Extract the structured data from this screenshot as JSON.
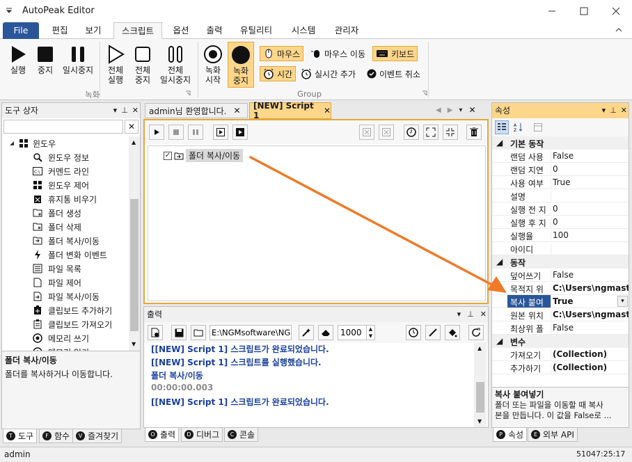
{
  "app": {
    "title": "AutoPeak Editor"
  },
  "ribbon": {
    "tabs": [
      "File",
      "편집",
      "보기",
      "스크립트",
      "옵션",
      "출력",
      "유틸리티",
      "시스템",
      "관리자"
    ],
    "active_tab": "스크립트",
    "group_record_label": "녹화",
    "group_group_label": "Group",
    "buttons": {
      "run": "실행",
      "stop": "중지",
      "pause": "일시중지",
      "run_all_1": "전체",
      "run_all_2": "실행",
      "stop_all_1": "전체",
      "stop_all_2": "중지",
      "pause_all_1": "전체",
      "pause_all_2": "일시중지",
      "rec_start_1": "녹화",
      "rec_start_2": "시작",
      "rec_stop_1": "녹화",
      "rec_stop_2": "중지",
      "mouse": "마우스",
      "mouse_move": "마우스 이동",
      "keyboard": "키보드",
      "time": "시간",
      "realtime_add": "실시간 추가",
      "event_cancel": "이벤트 취소"
    },
    "accent": "#2b579a",
    "highlight": "#fcd68a"
  },
  "toolbox": {
    "title": "도구 상자",
    "search_value": "",
    "root": "윈도우",
    "items": [
      "윈도우 정보",
      "커멘드 라인",
      "윈도우 제어",
      "휴지통 비우기",
      "폴더 생성",
      "폴더 삭제",
      "폴더 복사/이동",
      "폴더 변화 이벤트",
      "파일 목록",
      "파일 제어",
      "파일 복사/이동",
      "클립보드 추가하기",
      "클립보드 가져오기",
      "메모리 쓰기",
      "메모리 읽기"
    ],
    "desc_title": "폴더 복사/이동",
    "desc_text": "폴더를 복사하거나 이동합니다.",
    "bottom_tabs": [
      "도구",
      "함수",
      "즐겨찾기"
    ],
    "bottom_tab_keys": [
      "T",
      "F",
      "V"
    ]
  },
  "editor": {
    "tabs": [
      "admin님 환영합니다.",
      "[NEW] Script 1"
    ],
    "active_tab": "[NEW] Script 1",
    "script_node": "폴더 복사/이동",
    "node_checked": true
  },
  "output": {
    "title": "출력",
    "path_value": "E:\\NGMsoftware\\NG",
    "count_value": "1000",
    "lines": [
      {
        "text": "[[NEW] Script 1] 스크립트가 완료되었습니다.",
        "color": "#1a3fa0"
      },
      {
        "text": "[[NEW] Script 1] 스크립트를 실행했습니다.",
        "color": "#1a3fa0"
      },
      {
        "text": "폴더 복사/이동",
        "color": "#1a3fa0"
      },
      {
        "text": "00:00:00.003",
        "color": "#8c8c8c"
      },
      {
        "text": "[[NEW] Script 1] 스크립트가 완료되었습니다.",
        "color": "#1a3fa0"
      }
    ],
    "bottom_tabs": [
      "출력",
      "디버그",
      "콘솔"
    ],
    "bottom_tab_keys": [
      "O",
      "D",
      "C"
    ]
  },
  "properties": {
    "title": "속성",
    "categories": [
      {
        "name": "기본 동작",
        "rows": [
          {
            "name": "랜덤 사용",
            "value": "False"
          },
          {
            "name": "랜덤 지연",
            "value": "0"
          },
          {
            "name": "사용 여부",
            "value": "True"
          },
          {
            "name": "설명",
            "value": ""
          },
          {
            "name": "실행 전 지",
            "value": "0"
          },
          {
            "name": "실행 후 지",
            "value": "0"
          },
          {
            "name": "실행율",
            "value": "100"
          },
          {
            "name": "아이디",
            "value": ""
          }
        ]
      },
      {
        "name": "동작",
        "rows": [
          {
            "name": "덮어쓰기",
            "value": "False"
          },
          {
            "name": "목적지 위",
            "value": "C:\\Users\\ngmaste"
          },
          {
            "name": "복사 붙여",
            "value": "True",
            "selected": true
          },
          {
            "name": "원본 위치",
            "value": "C:\\Users\\ngmaste"
          },
          {
            "name": "최상위 폴",
            "value": "False"
          }
        ]
      },
      {
        "name": "변수",
        "rows": [
          {
            "name": "가져오기",
            "value": "(Collection)"
          },
          {
            "name": "추가하기",
            "value": "(Collection)"
          }
        ]
      }
    ],
    "desc_title": "복사 붙여넣기",
    "desc_text_1": "폴더 또는 파일을 이동할 때 복사",
    "desc_text_2": "본을 만듭니다. 이 값을 False로 ...",
    "bottom_tabs": [
      "속성",
      "외부 API"
    ],
    "bottom_tab_keys": [
      "P",
      "E"
    ]
  },
  "status": {
    "user": "admin",
    "time": "51047:25:17"
  },
  "arrow_color": "#f07a28"
}
